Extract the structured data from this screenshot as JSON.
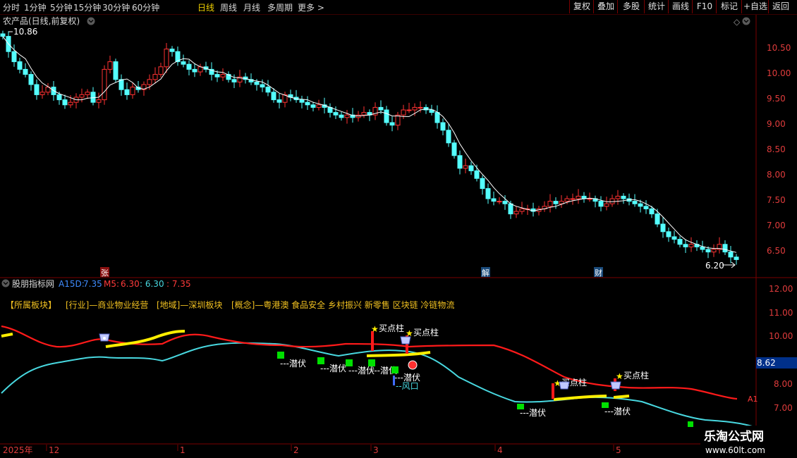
{
  "toolbar": {
    "periods": [
      "分时",
      "1分钟",
      "5分钟",
      "15分钟",
      "30分钟",
      "60分钟",
      "日线",
      "周线",
      "月线",
      "多周期",
      "更多 >"
    ],
    "active_period": "日线",
    "right_buttons": [
      "复权",
      "叠加",
      "多股",
      "统计",
      "画线",
      "F10",
      "标记",
      "+自选",
      "返回"
    ]
  },
  "main_chart": {
    "title": "农产品(日线,前复权)",
    "high_label": "10.86",
    "low_label": "6.20",
    "price_ticks": [
      "10.50",
      "10.00",
      "9.50",
      "9.00",
      "8.50",
      "8.00",
      "7.50",
      "7.00",
      "6.50"
    ],
    "event_markers": [
      "张",
      "解",
      "财"
    ],
    "diamond_icon": "◇"
  },
  "indicator": {
    "name": "股朋指标网",
    "a15d_label": "A15D:",
    "a15d_value": "7.35",
    "m5_label": "M5:",
    "m5_value": "6.30",
    "v3": ": 6.30",
    "v4": ": 7.35",
    "sector_line": {
      "belong": "【所属板块】",
      "industry": "[行业]—商业物业经营",
      "region": "[地域]—深圳板块",
      "concept": "[概念]—粤港澳 食品安全 乡村振兴 新零售 区块链 冷链物流"
    },
    "ticks": [
      "12.00",
      "11.00",
      "10.00",
      "9.00",
      "8.00",
      "7.00"
    ],
    "current_value": "8.62",
    "a1_label": "A1",
    "signal_labels": {
      "buy": "买点柱",
      "lurk": "---潜伏",
      "windmouth": "--风口"
    }
  },
  "time_axis": {
    "labels": [
      "2025年",
      "12",
      "1",
      "2",
      "3",
      "4",
      "5"
    ]
  },
  "watermark": {
    "name": "乐淘公式网",
    "url": "www.60lt.com"
  },
  "colors": {
    "up_candle": "#ff3232",
    "down_candle": "#54ffff",
    "ma_line": "#ffffff",
    "red_line": "#ff1a1a",
    "cyan_line": "#48d8e0",
    "yellow_line": "#ffee00",
    "signal_green": "#00e000",
    "axis_border": "#7a0000"
  }
}
